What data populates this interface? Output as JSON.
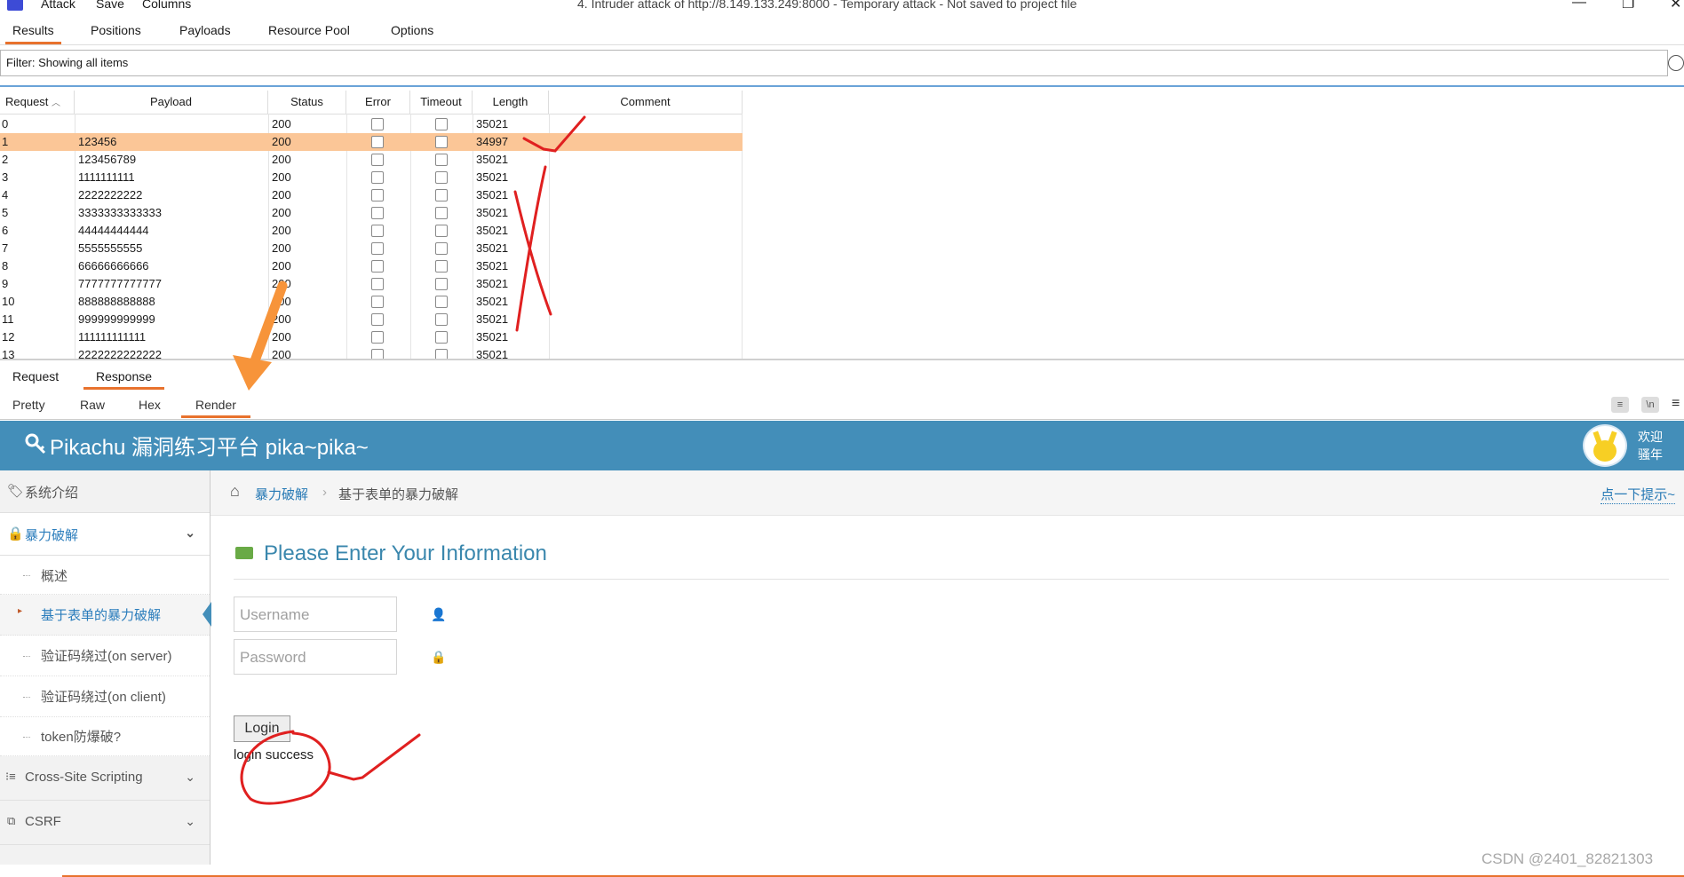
{
  "menu": {
    "attack": "Attack",
    "save": "Save",
    "columns": "Columns",
    "window_title": "4. Intruder attack of http://8.149.133.249:8000 - Temporary attack - Not saved to project file"
  },
  "result_tabs": [
    "Results",
    "Positions",
    "Payloads",
    "Resource Pool",
    "Options"
  ],
  "filter": {
    "text": "Filter: Showing all items"
  },
  "table": {
    "headers": [
      "Request",
      "Payload",
      "Status",
      "Error",
      "Timeout",
      "Length",
      "Comment"
    ],
    "rows": [
      {
        "request": "0",
        "payload": "",
        "status": "200",
        "length": "35021"
      },
      {
        "request": "1",
        "payload": "123456",
        "status": "200",
        "length": "34997"
      },
      {
        "request": "2",
        "payload": "123456789",
        "status": "200",
        "length": "35021"
      },
      {
        "request": "3",
        "payload": "1111111111",
        "status": "200",
        "length": "35021"
      },
      {
        "request": "4",
        "payload": "2222222222",
        "status": "200",
        "length": "35021"
      },
      {
        "request": "5",
        "payload": "3333333333333",
        "status": "200",
        "length": "35021"
      },
      {
        "request": "6",
        "payload": "44444444444",
        "status": "200",
        "length": "35021"
      },
      {
        "request": "7",
        "payload": "5555555555",
        "status": "200",
        "length": "35021"
      },
      {
        "request": "8",
        "payload": "66666666666",
        "status": "200",
        "length": "35021"
      },
      {
        "request": "9",
        "payload": "7777777777777",
        "status": "200",
        "length": "35021"
      },
      {
        "request": "10",
        "payload": "888888888888",
        "status": "200",
        "length": "35021"
      },
      {
        "request": "11",
        "payload": "999999999999",
        "status": "200",
        "length": "35021"
      },
      {
        "request": "12",
        "payload": "111111111111",
        "status": "200",
        "length": "35021"
      },
      {
        "request": "13",
        "payload": "2222222222222",
        "status": "200",
        "length": "35021"
      }
    ]
  },
  "rr_tabs": [
    "Request",
    "Response"
  ],
  "view_tabs": [
    "Pretty",
    "Raw",
    "Hex",
    "Render"
  ],
  "render": {
    "brand": "Pikachu 漏洞练习平台 pika~pika~",
    "welcome": [
      "欢迎",
      "骚年"
    ],
    "sidebar": {
      "intro": "系统介绍",
      "brute": "暴力破解",
      "sub": [
        "概述",
        "基于表单的暴力破解",
        "验证码绕过(on server)",
        "验证码绕过(on client)",
        "token防爆破?"
      ],
      "xss": "Cross-Site Scripting",
      "csrf": "CSRF"
    },
    "breadcrumb": [
      "暴力破解",
      "基于表单的暴力破解"
    ],
    "hint": "点一下提示~",
    "title": "Please Enter Your Information",
    "username_placeholder": "Username",
    "password_placeholder": "Password",
    "login": "Login",
    "message": "login success"
  },
  "watermark": "CSDN @2401_82821303",
  "annotation_colors": {
    "ink": "#e02020",
    "arrow": "#f7943a"
  }
}
